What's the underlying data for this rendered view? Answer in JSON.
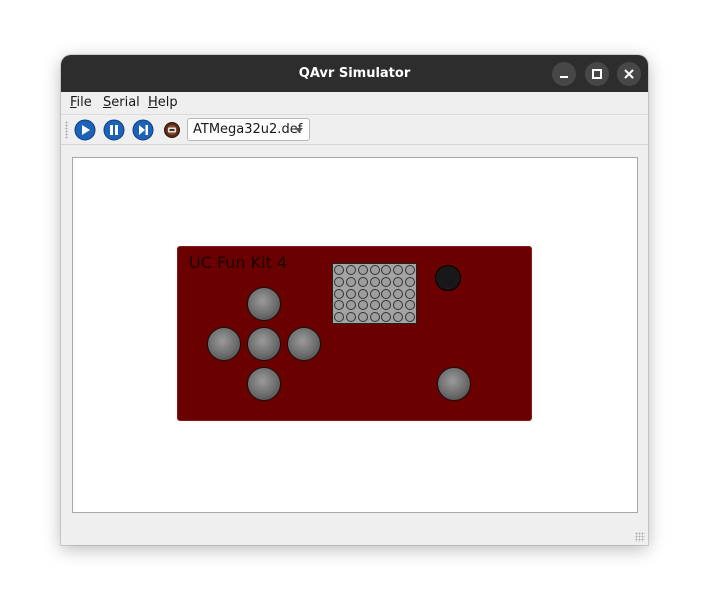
{
  "window": {
    "title": "QAvr Simulator"
  },
  "menubar": {
    "items": [
      {
        "label_u": "F",
        "label_rest": "ile"
      },
      {
        "label_u": "S",
        "label_rest": "erial"
      },
      {
        "label_u": "H",
        "label_rest": "elp"
      }
    ]
  },
  "toolbar": {
    "buttons": [
      "play-icon",
      "pause-icon",
      "step-icon",
      "avr-chip-icon"
    ],
    "device_select": {
      "value": "ATMega32u2.def"
    }
  },
  "board": {
    "label": "UC Fun Kit 4",
    "color": "#6b0000",
    "led_matrix": {
      "rows": 5,
      "cols": 7
    },
    "dpad_buttons": [
      "up",
      "left",
      "center",
      "right",
      "down"
    ],
    "extra_button": "push-button",
    "indicator_led": "off"
  },
  "colors": {
    "titlebar": "#2d2d2d",
    "accent_play": "#1a5fb4",
    "board": "#6b0000"
  }
}
